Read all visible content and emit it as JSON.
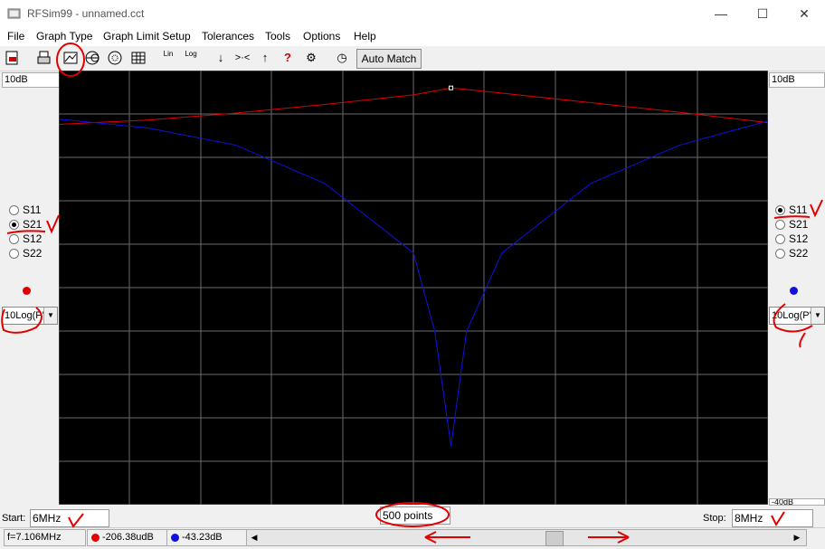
{
  "window": {
    "title": "RFSim99 - unnamed.cct",
    "minimize": "—",
    "maximize": "☐",
    "close": "✕"
  },
  "menu": [
    "File",
    "Graph Type",
    "Graph Limit Setup",
    "Tolerances",
    "Tools",
    "Options",
    "Help"
  ],
  "toolbar": {
    "lin": "Lin",
    "log": "Log",
    "automatch": "Auto Match",
    "icons": [
      "print-preview-icon",
      "print-icon",
      "graph-type-icon",
      "smith-chart-icon",
      "polar-chart-icon",
      "table-icon",
      "lin-icon",
      "log-icon",
      "marker-down-icon",
      "zoom-icon",
      "marker-up-icon",
      "help-icon",
      "tune-icon",
      "clock-icon"
    ]
  },
  "left_panel": {
    "top_field": "10dB",
    "radio_options": [
      "S11",
      "S21",
      "S12",
      "S22"
    ],
    "selected": "S21",
    "trace_color": "#e00000",
    "scale_combo": "10Log(P'"
  },
  "right_panel": {
    "top_field": "10dB",
    "radio_options": [
      "S11",
      "S21",
      "S12",
      "S22"
    ],
    "selected": "S11",
    "trace_color": "#1010e0",
    "scale_combo": "10Log(P'",
    "bottom_field_partial": "-40dB"
  },
  "bottom": {
    "start_label": "Start:",
    "start_value": "6MHz",
    "points": "500 points",
    "stop_label": "Stop:",
    "stop_value": "8MHz"
  },
  "status": {
    "frequency": "f=7.106MHz",
    "red_value": "-206.38udB",
    "blue_value": "-43.23dB",
    "scroll_left": "◀",
    "scroll_right": "▶"
  },
  "chart_data": {
    "type": "line",
    "x_range": [
      "6MHz",
      "8MHz"
    ],
    "points": 500,
    "grid": true,
    "series": [
      {
        "color": "#e00000",
        "x": [
          6.0,
          6.25,
          6.5,
          6.75,
          7.0,
          7.106,
          7.25,
          7.5,
          7.75,
          8.0
        ],
        "y": [
          -6.2,
          -5.7,
          -4.9,
          -3.9,
          -2.8,
          -2.0,
          -2.6,
          -3.7,
          -4.8,
          -6.0
        ]
      },
      {
        "color": "#1010e0",
        "x": [
          6.0,
          6.25,
          6.5,
          6.75,
          7.0,
          7.06,
          7.106,
          7.15,
          7.25,
          7.5,
          7.75,
          8.0
        ],
        "y": [
          -5.6,
          -6.6,
          -8.6,
          -13,
          -21,
          -30,
          -43.23,
          -30,
          -21,
          -13,
          -8.6,
          -5.8
        ]
      }
    ]
  }
}
